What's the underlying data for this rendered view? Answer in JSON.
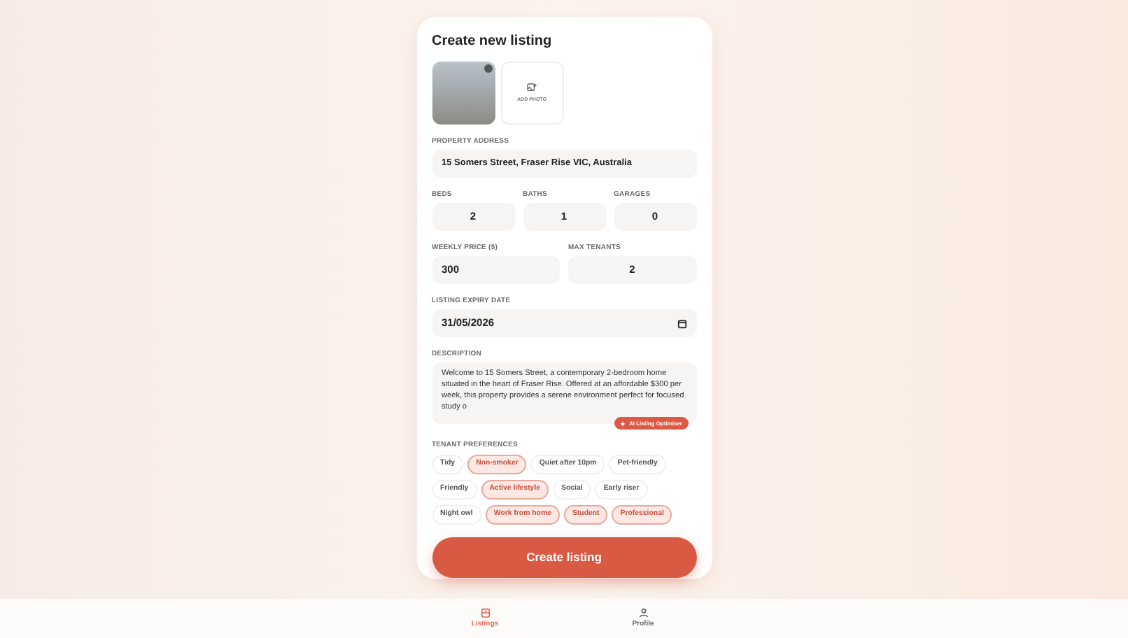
{
  "title": "Create new listing",
  "photos": {
    "add_label": "ADD PHOTO"
  },
  "address": {
    "label": "PROPERTY ADDRESS",
    "value": "15 Somers Street, Fraser Rise VIC, Australia"
  },
  "counts": [
    {
      "label": "BEDS",
      "value": "2"
    },
    {
      "label": "BATHS",
      "value": "1"
    },
    {
      "label": "GARAGES",
      "value": "0"
    }
  ],
  "price": {
    "label": "WEEKLY PRICE ($)",
    "value": "300"
  },
  "tenants": {
    "label": "MAX TENANTS",
    "value": "2"
  },
  "expiry": {
    "label": "LISTING EXPIRY DATE",
    "value": "31/05/2026"
  },
  "description": {
    "label": "DESCRIPTION",
    "value": "Welcome to 15 Somers Street, a contemporary 2-bedroom home situated in the heart of Fraser Rise. Offered at an affordable $300 per week, this property provides a serene environment perfect for focused study o",
    "ai_button": "AI Listing Optimiser"
  },
  "preferences": {
    "label": "TENANT PREFERENCES",
    "rows": [
      [
        {
          "label": "Tidy",
          "selected": false
        },
        {
          "label": "Non-smoker",
          "selected": true
        },
        {
          "label": "Quiet after 10pm",
          "selected": false
        },
        {
          "label": "Pet-friendly",
          "selected": false
        }
      ],
      [
        {
          "label": "Friendly",
          "selected": false
        },
        {
          "label": "Active lifestyle",
          "selected": true
        },
        {
          "label": "Social",
          "selected": false
        },
        {
          "label": "Early riser",
          "selected": false
        }
      ],
      [
        {
          "label": "Night owl",
          "selected": false
        },
        {
          "label": "Work from home",
          "selected": true
        },
        {
          "label": "Student",
          "selected": true
        },
        {
          "label": "Professional",
          "selected": true
        }
      ]
    ]
  },
  "submit": "Create listing",
  "nav": [
    {
      "label": "Listings",
      "kind": "listings",
      "selected": true
    },
    {
      "label": "Profile",
      "kind": "profile",
      "selected": false
    }
  ]
}
